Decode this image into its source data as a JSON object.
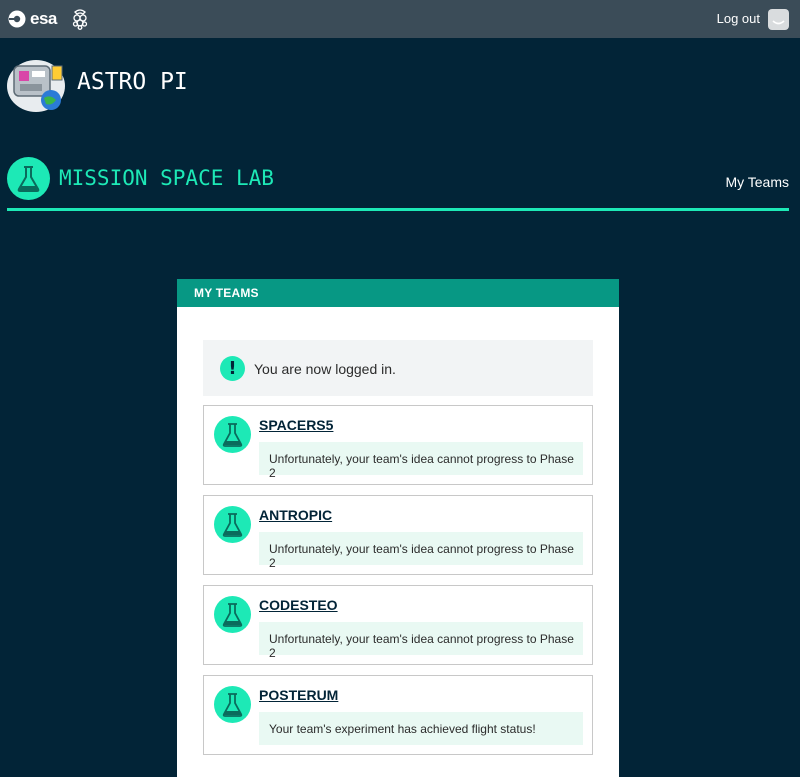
{
  "topbar": {
    "esa_label": "esa",
    "logout_label": "Log out"
  },
  "header": {
    "app_title": "ASTRO PI"
  },
  "mission": {
    "title": "MISSION SPACE LAB",
    "nav_label": "My Teams"
  },
  "panel": {
    "heading": "MY TEAMS",
    "alert_icon": "!",
    "alert_text": "You are now logged in.",
    "teams": [
      {
        "name": "SPACERS5",
        "status": "Unfortunately, your team's idea cannot progress to Phase 2"
      },
      {
        "name": "ANTROPIC",
        "status": "Unfortunately, your team's idea cannot progress to Phase 2"
      },
      {
        "name": "CODESTEO",
        "status": "Unfortunately, your team's idea cannot progress to Phase 2"
      },
      {
        "name": "POSTERUM",
        "status": "Your team's experiment has achieved flight status!"
      }
    ]
  },
  "colors": {
    "background": "#022437",
    "topbar": "#3b4c58",
    "accent": "#1de9b6",
    "panel_header": "#079884",
    "status_bg": "#e9f9f3"
  },
  "icons": [
    "esa-logo-icon",
    "raspberry-pi-icon",
    "user-avatar-icon",
    "astro-pi-logo-icon",
    "flask-icon",
    "exclamation-icon"
  ]
}
